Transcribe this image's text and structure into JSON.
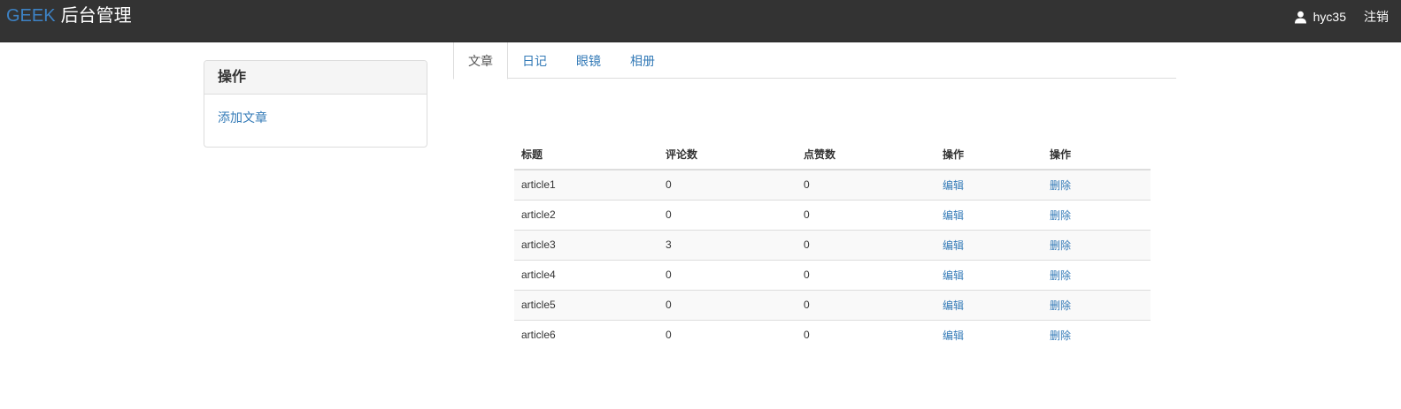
{
  "navbar": {
    "brand_geek": "GEEK",
    "brand_title": "后台管理",
    "username": "hyc35",
    "logout_label": "注销",
    "user_icon": "user-icon"
  },
  "sidebar": {
    "panel_title": "操作",
    "add_article_label": "添加文章"
  },
  "tabs": [
    {
      "label": "文章",
      "active": true
    },
    {
      "label": "日记",
      "active": false
    },
    {
      "label": "眼镜",
      "active": false
    },
    {
      "label": "相册",
      "active": false
    }
  ],
  "table": {
    "headers": [
      "标题",
      "评论数",
      "点赞数",
      "操作",
      "操作"
    ],
    "rows": [
      {
        "title": "article1",
        "comments": "0",
        "likes": "0",
        "edit": "编辑",
        "delete": "删除"
      },
      {
        "title": "article2",
        "comments": "0",
        "likes": "0",
        "edit": "编辑",
        "delete": "删除"
      },
      {
        "title": "article3",
        "comments": "3",
        "likes": "0",
        "edit": "编辑",
        "delete": "删除"
      },
      {
        "title": "article4",
        "comments": "0",
        "likes": "0",
        "edit": "编辑",
        "delete": "删除"
      },
      {
        "title": "article5",
        "comments": "0",
        "likes": "0",
        "edit": "编辑",
        "delete": "删除"
      },
      {
        "title": "article6",
        "comments": "0",
        "likes": "0",
        "edit": "编辑",
        "delete": "删除"
      }
    ]
  },
  "colors": {
    "navbar_bg": "#333333",
    "brand_accent": "#3d82c4",
    "link": "#337ab7"
  }
}
